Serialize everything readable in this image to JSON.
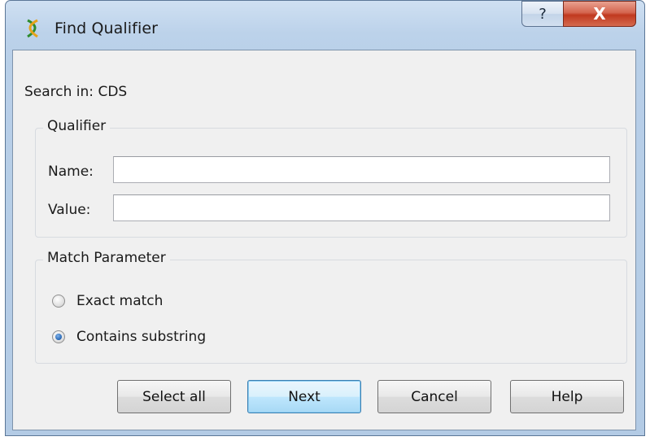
{
  "window": {
    "title": "Find Qualifier",
    "help_glyph": "?",
    "close_glyph": "X"
  },
  "search": {
    "label": "Search in:",
    "value": "CDS"
  },
  "qualifier": {
    "title": "Qualifier",
    "name_label": "Name:",
    "name_value": "",
    "value_label": "Value:",
    "value_value": ""
  },
  "match": {
    "title": "Match Parameter",
    "options": [
      {
        "label": "Exact match",
        "checked": false
      },
      {
        "label": "Contains substring",
        "checked": true
      }
    ]
  },
  "buttons": {
    "select_all": "Select all",
    "next": "Next",
    "cancel": "Cancel",
    "help": "Help"
  },
  "icons": {
    "app": "ugene-dna-icon",
    "help": "help-icon",
    "close": "close-icon"
  }
}
